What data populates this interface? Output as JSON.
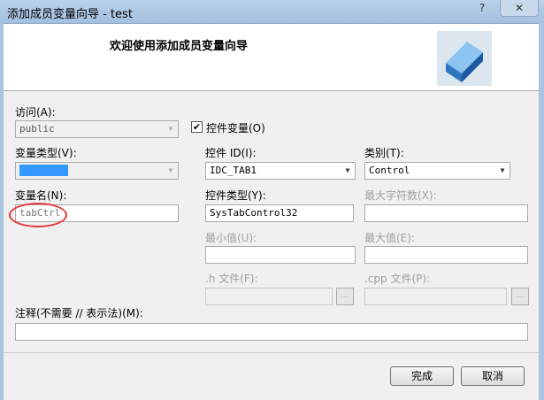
{
  "window": {
    "title": "添加成员变量向导 - test",
    "help": "?",
    "close": "✕"
  },
  "header": {
    "title": "欢迎使用添加成员变量向导"
  },
  "form": {
    "access_label": "访问(A):",
    "access_value": "public",
    "control_var_label": "控件变量(O)",
    "control_var_checked": true,
    "var_type_label": "变量类型(V):",
    "var_type_value": "CTabCtrl",
    "control_id_label": "控件 ID(I):",
    "control_id_value": "IDC_TAB1",
    "category_label": "类别(T):",
    "category_value": "Control",
    "var_name_label": "变量名(N):",
    "var_name_value": "tabCtrl",
    "control_type_label": "控件类型(Y):",
    "control_type_value": "SysTabControl32",
    "max_chars_label": "最大字符数(X):",
    "max_chars_value": "",
    "min_label": "最小值(U):",
    "min_value": "",
    "max_label": "最大值(E):",
    "max_value": "",
    "h_file_label": ".h 文件(F):",
    "h_file_value": "",
    "cpp_file_label": ".cpp 文件(P):",
    "cpp_file_value": "",
    "browse_label": "...",
    "comment_label": "注释(不需要 // 表示法)(M):",
    "comment_value": ""
  },
  "buttons": {
    "finish": "完成",
    "cancel": "取消"
  }
}
